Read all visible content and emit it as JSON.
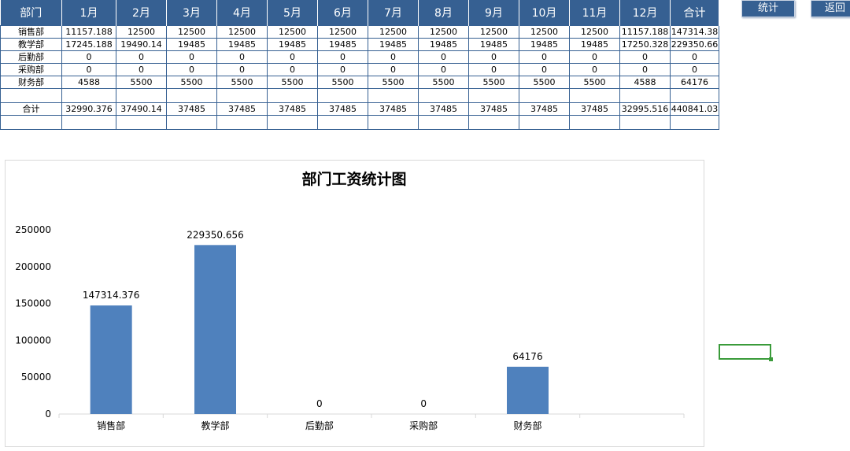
{
  "table": {
    "headers": [
      "部门",
      "1月",
      "2月",
      "3月",
      "4月",
      "5月",
      "6月",
      "7月",
      "8月",
      "9月",
      "10月",
      "11月",
      "12月",
      "合计"
    ],
    "rows": [
      [
        "销售部",
        "11157.188",
        "12500",
        "12500",
        "12500",
        "12500",
        "12500",
        "12500",
        "12500",
        "12500",
        "12500",
        "12500",
        "11157.188",
        "147314.38"
      ],
      [
        "教学部",
        "17245.188",
        "19490.14",
        "19485",
        "19485",
        "19485",
        "19485",
        "19485",
        "19485",
        "19485",
        "19485",
        "19485",
        "17250.328",
        "229350.66"
      ],
      [
        "后勤部",
        "0",
        "0",
        "0",
        "0",
        "0",
        "0",
        "0",
        "0",
        "0",
        "0",
        "0",
        "0",
        "0"
      ],
      [
        "采购部",
        "0",
        "0",
        "0",
        "0",
        "0",
        "0",
        "0",
        "0",
        "0",
        "0",
        "0",
        "0",
        "0"
      ],
      [
        "财务部",
        "4588",
        "5500",
        "5500",
        "5500",
        "5500",
        "5500",
        "5500",
        "5500",
        "5500",
        "5500",
        "5500",
        "4588",
        "64176"
      ],
      [
        "",
        "",
        "",
        "",
        "",
        "",
        "",
        "",
        "",
        "",
        "",
        "",
        "",
        ""
      ],
      [
        "合计",
        "32990.376",
        "37490.14",
        "37485",
        "37485",
        "37485",
        "37485",
        "37485",
        "37485",
        "37485",
        "37485",
        "37485",
        "32995.516",
        "440841.03"
      ],
      [
        "",
        "",
        "",
        "",
        "",
        "",
        "",
        "",
        "",
        "",
        "",
        "",
        "",
        ""
      ]
    ]
  },
  "buttons": {
    "stats": "统计",
    "back": "返回"
  },
  "colors": {
    "header_bg": "#366092",
    "bar": "#4f81bd",
    "selection": "#3a9b3a"
  },
  "chart_data": {
    "type": "bar",
    "title": "部门工资统计图",
    "categories": [
      "销售部",
      "教学部",
      "后勤部",
      "采购部",
      "财务部",
      ""
    ],
    "values": [
      147314.376,
      229350.656,
      0,
      0,
      64176,
      null
    ],
    "data_labels": [
      "147314.376",
      "229350.656",
      "0",
      "0",
      "64176",
      ""
    ],
    "ylim": [
      0,
      250000
    ],
    "yticks": [
      0,
      50000,
      100000,
      150000,
      200000,
      250000
    ],
    "xlabel": "",
    "ylabel": "",
    "grid": false,
    "legend": "none"
  }
}
